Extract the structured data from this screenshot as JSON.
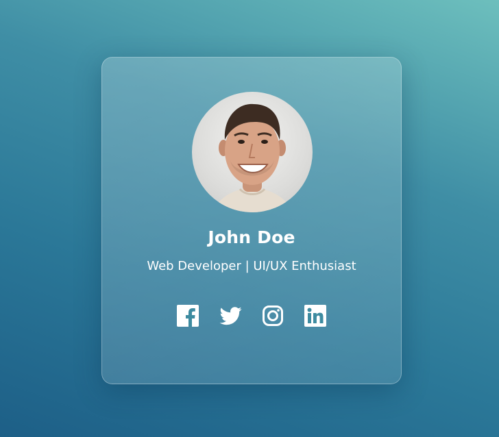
{
  "profile": {
    "name": "John Doe",
    "title": "Web Developer | UI/UX Enthusiast",
    "avatar_alt": "Profile photo"
  },
  "socials": [
    {
      "icon": "facebook-icon"
    },
    {
      "icon": "twitter-icon"
    },
    {
      "icon": "instagram-icon"
    },
    {
      "icon": "linkedin-icon"
    }
  ],
  "colors": {
    "background_top": "#6dbfbd",
    "background_bottom": "#1d5f87",
    "text": "#ffffff"
  }
}
